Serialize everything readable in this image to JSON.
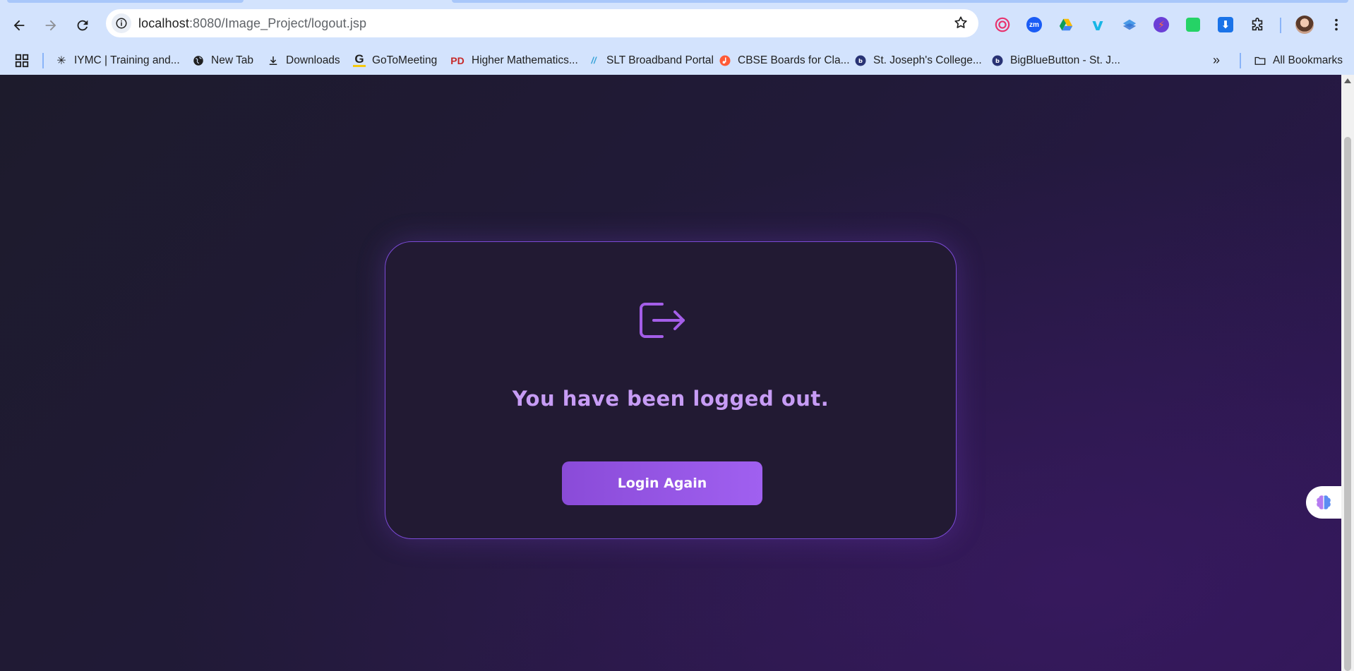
{
  "browser": {
    "url_host": "localhost",
    "url_rest": ":8080/Image_Project/logout.jsp",
    "extensions": [
      "target-icon",
      "zoom-icon",
      "google-drive-icon",
      "vimeo-icon",
      "layers-icon",
      "bolt-icon",
      "whatsapp-icon",
      "download-icon"
    ],
    "bookmarks": [
      {
        "label": "IYMC | Training and...",
        "icon": "iymc-icon"
      },
      {
        "label": "New Tab",
        "icon": "globe-icon"
      },
      {
        "label": "Downloads",
        "icon": "download-icon"
      },
      {
        "label": "GoToMeeting",
        "icon": "gotomeeting-icon"
      },
      {
        "label": "Higher Mathematics...",
        "icon": "pd-icon"
      },
      {
        "label": "SLT Broadband Portal",
        "icon": "slt-icon"
      },
      {
        "label": "CBSE Boards for Cla...",
        "icon": "music-icon"
      },
      {
        "label": "St. Joseph's College...",
        "icon": "bigbluebutton-icon"
      },
      {
        "label": "BigBlueButton - St. J...",
        "icon": "bigbluebutton-icon"
      }
    ],
    "all_bookmarks_label": "All Bookmarks"
  },
  "page": {
    "message": "You have been logged out.",
    "login_button": "Login Again",
    "accent_color": "#a060f0",
    "title_color": "#c79cf5"
  }
}
